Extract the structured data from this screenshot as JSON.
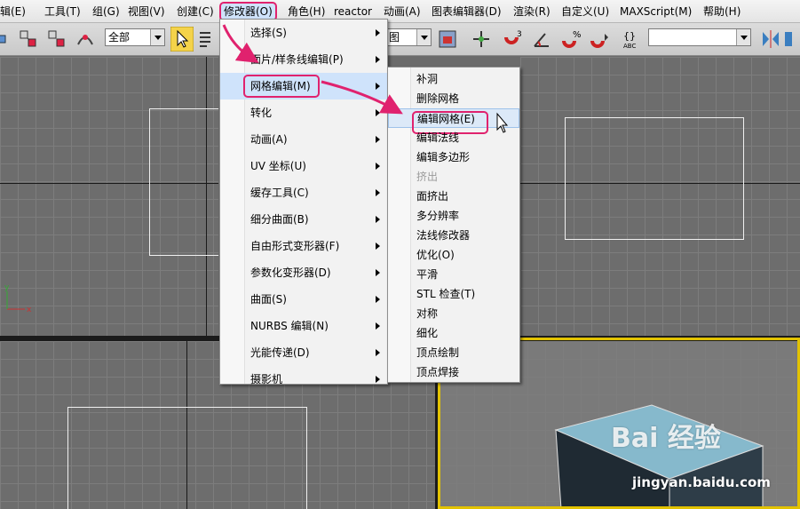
{
  "menubar": {
    "items": [
      "辑(E)",
      "工具(T)",
      "组(G)",
      "视图(V)",
      "创建(C)",
      "修改器(O)",
      "角色(H)",
      "reactor",
      "动画(A)",
      "图表编辑器(D)",
      "渲染(R)",
      "自定义(U)",
      "MAXScript(M)",
      "帮助(H)"
    ],
    "active": "修改器(O)"
  },
  "toolbar": {
    "selection_filter": "全部",
    "view_partial": "图"
  },
  "modifiers_menu": {
    "items": [
      {
        "label": "选择(S)",
        "submenu": true
      },
      {
        "label": "面片/样条线编辑(P)",
        "submenu": true
      },
      {
        "label": "网格编辑(M)",
        "submenu": true,
        "highlighted": true
      },
      {
        "label": "转化",
        "submenu": true
      },
      {
        "label": "动画(A)",
        "submenu": true
      },
      {
        "label": "UV 坐标(U)",
        "submenu": true
      },
      {
        "label": "缓存工具(C)",
        "submenu": true
      },
      {
        "label": "细分曲面(B)",
        "submenu": true
      },
      {
        "label": "自由形式变形器(F)",
        "submenu": true
      },
      {
        "label": "参数化变形器(D)",
        "submenu": true
      },
      {
        "label": "曲面(S)",
        "submenu": true
      },
      {
        "label": "NURBS 编辑(N)",
        "submenu": true
      },
      {
        "label": "光能传递(D)",
        "submenu": true
      },
      {
        "label": "摄影机",
        "submenu": true
      }
    ]
  },
  "mesh_edit_submenu": {
    "items": [
      {
        "label": "补洞"
      },
      {
        "label": "删除网格"
      },
      {
        "label": "编辑网格(E)",
        "highlighted": true
      },
      {
        "label": "编辑法线"
      },
      {
        "label": "编辑多边形"
      },
      {
        "label": "挤出",
        "disabled": true
      },
      {
        "label": "面挤出"
      },
      {
        "label": "多分辨率"
      },
      {
        "label": "法线修改器"
      },
      {
        "label": "优化(O)"
      },
      {
        "label": "平滑"
      },
      {
        "label": "STL 检查(T)"
      },
      {
        "label": "对称"
      },
      {
        "label": "细化"
      },
      {
        "label": "顶点绘制"
      },
      {
        "label": "顶点焊接"
      }
    ]
  },
  "viewport": {
    "axis_x": "x",
    "axis_y": "y"
  },
  "watermark": {
    "brand": "Bai 经验",
    "url": "jingyan.baidu.com"
  },
  "colors": {
    "highlight_outline": "#e0226e",
    "active_viewport_border": "#e2c200",
    "cube_top": "#86b9cc"
  }
}
